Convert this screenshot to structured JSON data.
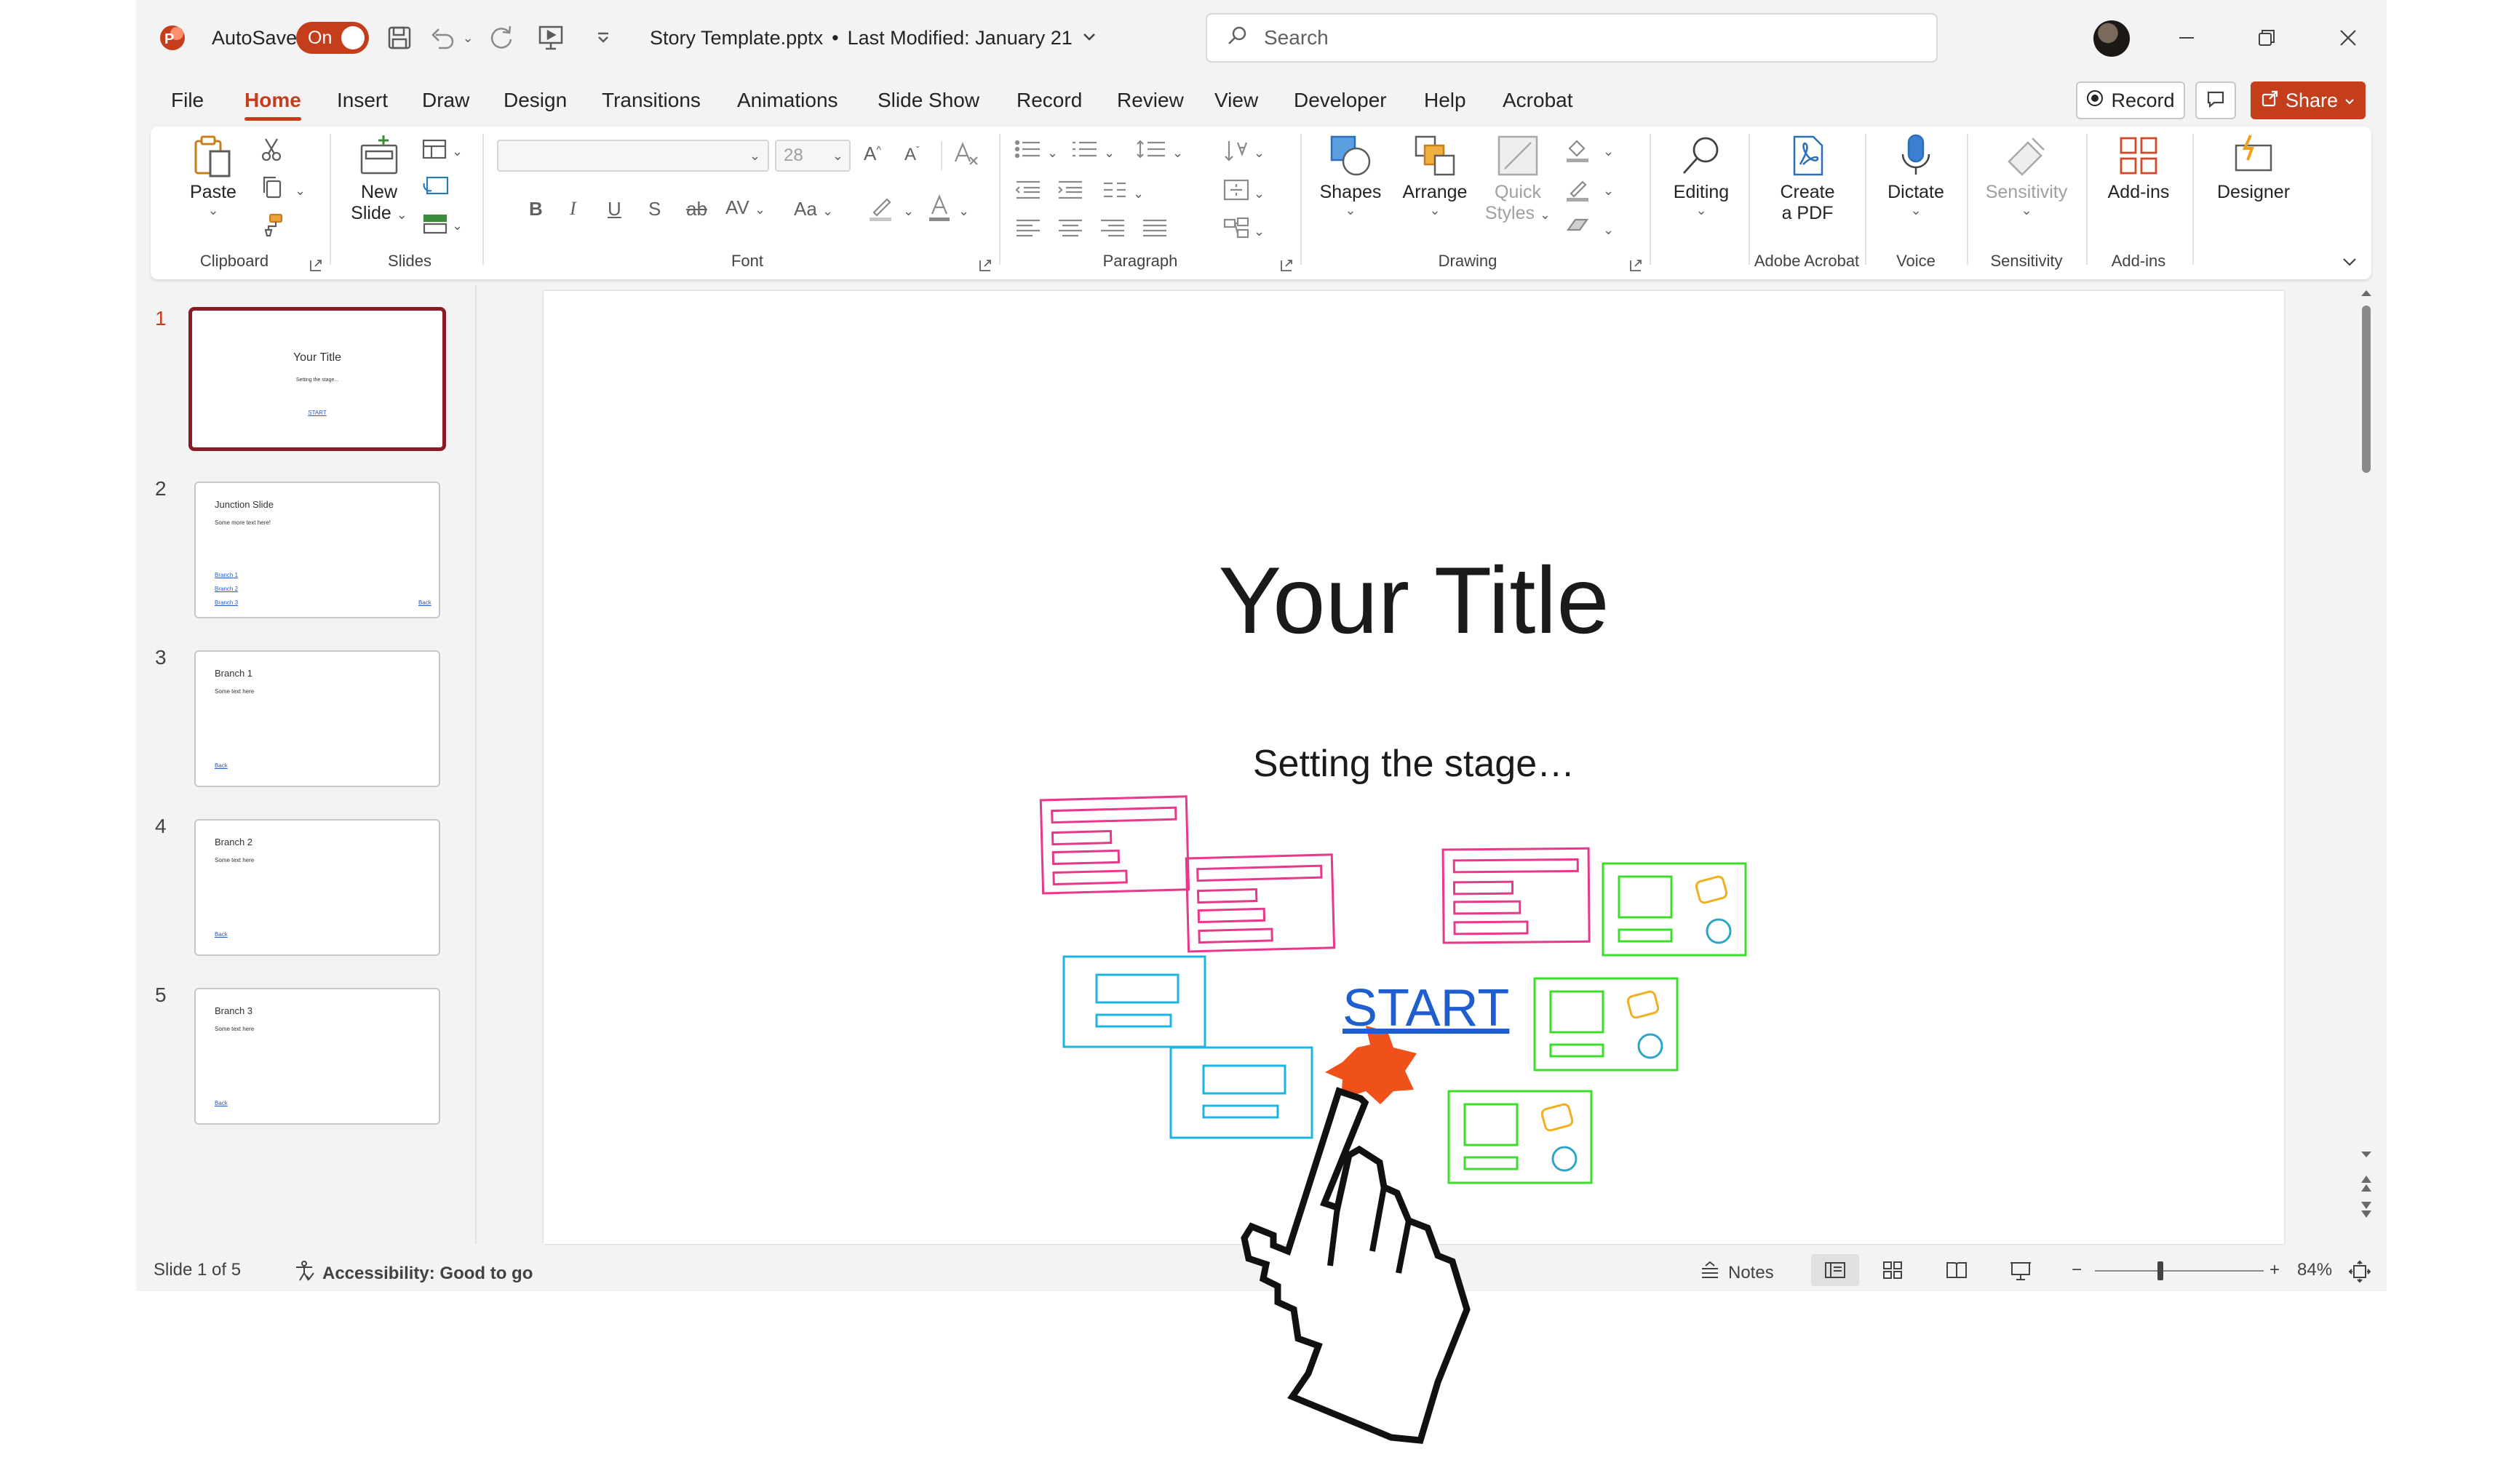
{
  "titlebar": {
    "autosave_label": "AutoSave",
    "autosave_state": "On",
    "doc_title": "Story Template.pptx",
    "separator": "•",
    "last_modified": "Last Modified: January 21",
    "search_placeholder": "Search"
  },
  "menu": {
    "tabs": [
      "File",
      "Home",
      "Insert",
      "Draw",
      "Design",
      "Transitions",
      "Animations",
      "Slide Show",
      "Record",
      "Review",
      "View",
      "Developer",
      "Help",
      "Acrobat"
    ],
    "active_tab": "Home",
    "record_label": "Record",
    "share_label": "Share"
  },
  "ribbon": {
    "paste": "Paste",
    "new_slide_line1": "New",
    "new_slide_line2": "Slide",
    "font_size": "28",
    "shapes": "Shapes",
    "arrange": "Arrange",
    "quick_styles_line1": "Quick",
    "quick_styles_line2": "Styles",
    "editing": "Editing",
    "create_pdf_line1": "Create",
    "create_pdf_line2": "a PDF",
    "dictate": "Dictate",
    "sensitivity": "Sensitivity",
    "addins": "Add-ins",
    "designer": "Designer",
    "groups": {
      "clipboard": "Clipboard",
      "slides": "Slides",
      "font": "Font",
      "paragraph": "Paragraph",
      "drawing": "Drawing",
      "adobe_acrobat": "Adobe Acrobat",
      "voice": "Voice",
      "sensitivity": "Sensitivity",
      "addins": "Add-ins"
    }
  },
  "thumbnails": [
    {
      "num": "1",
      "title": "Your Title",
      "body": "Setting the stage...",
      "links": [
        "START"
      ]
    },
    {
      "num": "2",
      "title": "Junction Slide",
      "body": "Some more text here!",
      "links": [
        "Branch 1",
        "Branch 2",
        "Branch 3"
      ],
      "back": "Back"
    },
    {
      "num": "3",
      "title": "Branch 1",
      "body": "Some text here",
      "links": [
        "Back"
      ]
    },
    {
      "num": "4",
      "title": "Branch 2",
      "body": "Some text here",
      "links": [
        "Back"
      ]
    },
    {
      "num": "5",
      "title": "Branch 3",
      "body": "Some text here",
      "links": [
        "Back"
      ]
    }
  ],
  "slide": {
    "title": "Your Title",
    "subtitle": "Setting the stage…",
    "start_link": "START"
  },
  "statusbar": {
    "slide_counter": "Slide 1 of 5",
    "accessibility": "Accessibility: Good to go",
    "notes": "Notes",
    "zoom_level": "84%"
  },
  "colors": {
    "accent": "#c43e1c",
    "active_thumb_border": "#8a1b26",
    "link_blue": "#1f5ecf",
    "art_pink": "#e8388a",
    "art_cyan": "#1cb5e0",
    "art_green": "#3cdc2a",
    "art_orange": "#f0501a"
  }
}
